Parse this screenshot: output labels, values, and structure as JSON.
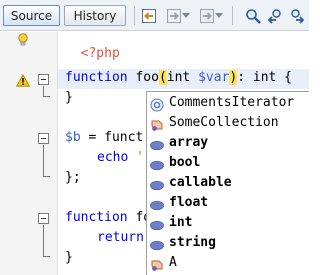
{
  "toolbar": {
    "tabs": [
      {
        "label": "Source",
        "active": true
      },
      {
        "label": "History",
        "active": false
      }
    ],
    "icons": [
      "back-history-icon",
      "last-edit-icon",
      "forward-icon",
      "find-icon",
      "find-previous-icon",
      "find-next-icon"
    ]
  },
  "editor": {
    "lines": {
      "l1_open": "<?php",
      "l3_kw": "function",
      "l3_name": " foo",
      "l3_paren_open": "(",
      "l3_type": "int",
      "l3_space": " ",
      "l3_param": "$var",
      "l3_paren_close": ")",
      "l3_rest": ": int {",
      "l4": "}",
      "l6_var": "$b",
      "l6_rest": " = funct",
      "l7_kw": "echo",
      "l7_rest": " '",
      "l8": "};",
      "l10_kw": "function",
      "l10_rest": " fo",
      "l11_kw": "return",
      "l12": "}"
    }
  },
  "completion": {
    "items": [
      {
        "label": "CommentsIterator",
        "icon": "class-icon",
        "bold": false
      },
      {
        "label": "SomeCollection",
        "icon": "interface-icon",
        "bold": false
      },
      {
        "label": "array",
        "icon": "php-keyword-icon",
        "bold": true
      },
      {
        "label": "bool",
        "icon": "php-keyword-icon",
        "bold": true
      },
      {
        "label": "callable",
        "icon": "php-keyword-icon",
        "bold": true
      },
      {
        "label": "float",
        "icon": "php-keyword-icon",
        "bold": true
      },
      {
        "label": "int",
        "icon": "php-keyword-icon",
        "bold": true
      },
      {
        "label": "string",
        "icon": "php-keyword-icon",
        "bold": true
      },
      {
        "label": "A",
        "icon": "interface-icon",
        "bold": false
      }
    ],
    "php_badge": "php"
  },
  "colors": {
    "keyword": "#0000e6",
    "variable": "#3a5fcd",
    "php_tag": "#e0523f",
    "brace_highlight": "#ffe35a",
    "line_highlight": "#e9effa"
  }
}
